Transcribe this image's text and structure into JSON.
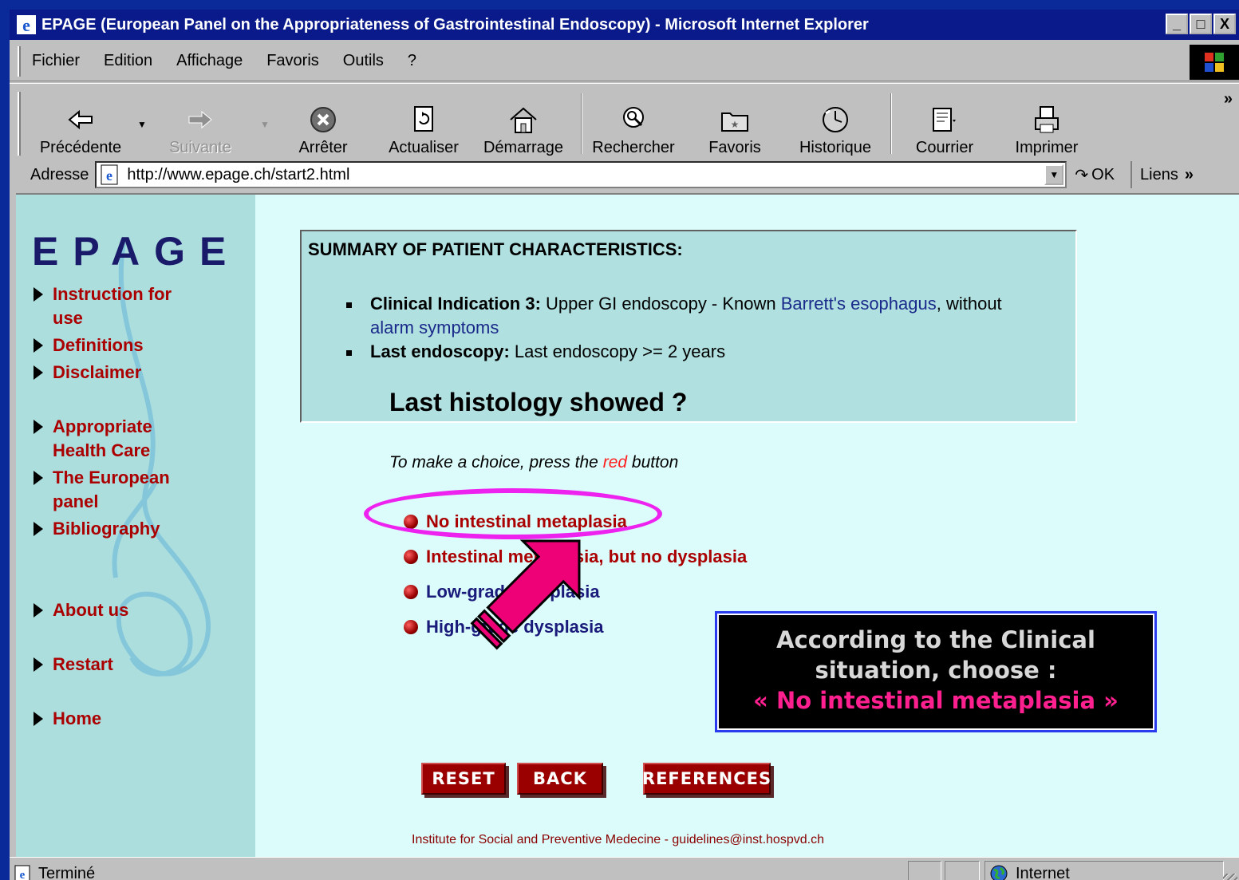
{
  "window": {
    "title": "EPAGE (European Panel on the Appropriateness of Gastrointestinal Endoscopy) - Microsoft Internet Explorer",
    "buttons": [
      "_",
      "□",
      "X"
    ]
  },
  "menu": {
    "items": [
      "Fichier",
      "Edition",
      "Affichage",
      "Favoris",
      "Outils",
      "?"
    ]
  },
  "toolbar": {
    "back": "Précédente",
    "forward": "Suivante",
    "stop": "Arrêter",
    "refresh": "Actualiser",
    "home": "Démarrage",
    "search": "Rechercher",
    "favorites": "Favoris",
    "history": "Historique",
    "mail": "Courrier",
    "print": "Imprimer",
    "more": "»"
  },
  "address": {
    "label": "Adresse",
    "url": "http://www.epage.ch/start2.html",
    "go": "OK",
    "links": "Liens"
  },
  "sidebar": {
    "logo": "EPAGE",
    "items": [
      {
        "line1": "Instruction for",
        "line2": "use"
      },
      {
        "line1": "Definitions",
        "line2": ""
      },
      {
        "line1": "Disclaimer",
        "line2": ""
      },
      {
        "line1": "Appropriate",
        "line2": "Health Care"
      },
      {
        "line1": "The European",
        "line2": "panel"
      },
      {
        "line1": "Bibliography",
        "line2": ""
      },
      {
        "line1": "About us",
        "line2": ""
      },
      {
        "line1": "Restart",
        "line2": ""
      },
      {
        "line1": "Home",
        "line2": ""
      }
    ]
  },
  "summary": {
    "title": "SUMMARY OF PATIENT CHARACTERISTICS:",
    "indication_label": "Clinical Indication 3:",
    "indication_text": " Upper GI endoscopy - Known ",
    "indication_link": "Barrett's esophagus",
    "indication_after": ", without",
    "indication_link2": "alarm symptoms",
    "last_label": "Last endoscopy:",
    "last_text": " Last endoscopy >= 2 years",
    "question": "Last histology showed ?"
  },
  "instruction": {
    "before": "To make a choice, press the ",
    "red": "red",
    "after": " button"
  },
  "options": [
    "No intestinal metaplasia",
    "Intestinal metaplasia, but no dysplasia",
    "Low-grade dysplasia",
    "High-grade dysplasia"
  ],
  "callout": {
    "line1": "According to the Clinical",
    "line2": "situation, choose :",
    "line3": "« No intestinal metaplasia »"
  },
  "buttons": {
    "reset": "RESET",
    "back": "BACK",
    "references": "REFERENCES"
  },
  "footer": "Institute for Social and Preventive Medecine - guidelines@inst.hospvd.ch",
  "status": {
    "text": "Terminé",
    "zone": "Internet"
  },
  "colors": {
    "title_bar": "#0a1a8a",
    "sidebar": "#acdede",
    "content": "#dcfcfc",
    "highlight": "#ee22ee",
    "arrow": "#ee0077",
    "link_red": "#aa0000",
    "link_blue": "#1a2a8a"
  }
}
